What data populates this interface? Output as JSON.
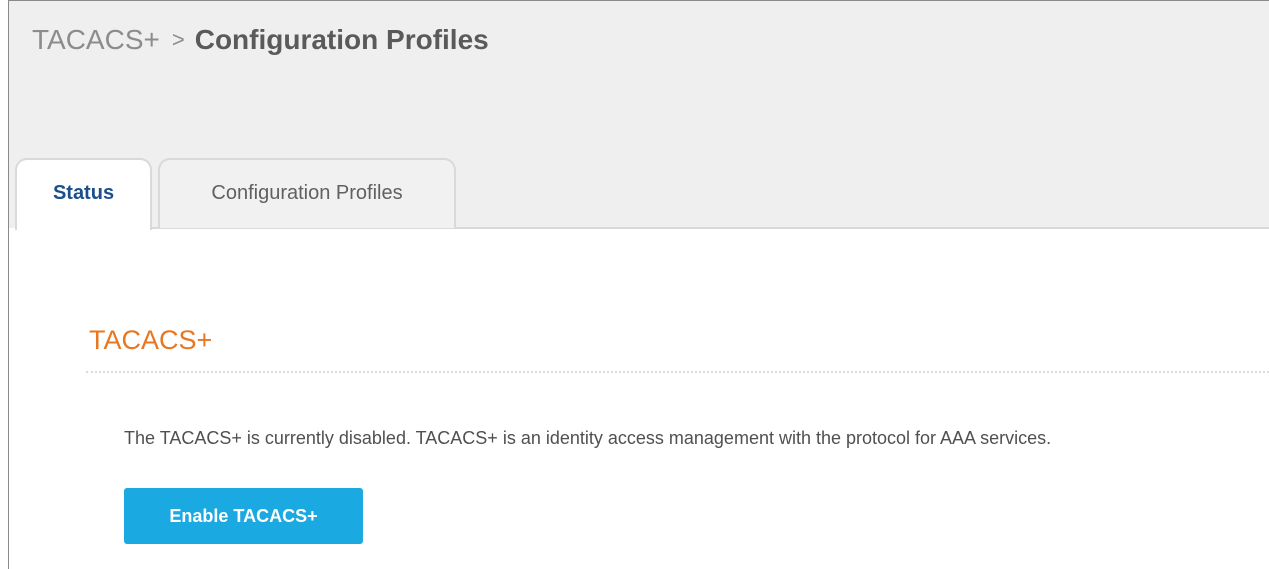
{
  "breadcrumb": {
    "root": "TACACS+",
    "separator": ">",
    "current": "Configuration Profiles"
  },
  "tabs": [
    {
      "label": "Status",
      "active": true
    },
    {
      "label": "Configuration Profiles",
      "active": false
    }
  ],
  "section": {
    "title": "TACACS+",
    "description": "The TACACS+ is currently disabled. TACACS+ is an identity access management with the protocol for AAA services.",
    "button_label": "Enable TACACS+"
  },
  "colors": {
    "header_bg": "#efefef",
    "active_tab_text": "#1a4f8b",
    "section_title": "#e87722",
    "primary_button": "#1ba9e1"
  }
}
